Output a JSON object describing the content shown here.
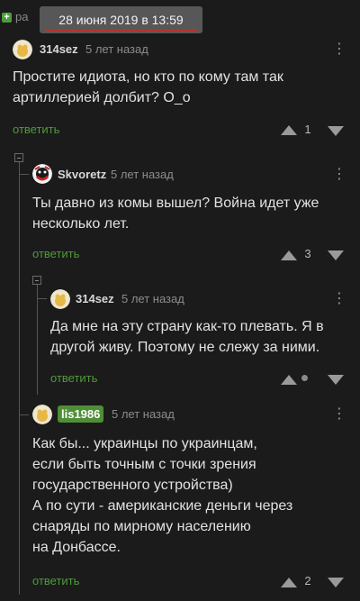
{
  "banner": {
    "prefix": "ра",
    "date": "28 июня 2019 в 13:59",
    "plus": "+"
  },
  "comments": [
    {
      "username": "314sez",
      "ago": "5 лет назад",
      "lines": [
        "Простите идиота, но кто по кому там так",
        "артиллерией долбит? О_о"
      ],
      "reply": "ответить",
      "rating": "1"
    },
    {
      "username": "Skvoretz",
      "ago": "5 лет назад",
      "lines": [
        "Ты давно из комы вышел? Война идет уже",
        "несколько лет."
      ],
      "reply": "ответить",
      "rating": "3"
    },
    {
      "username": "314sez",
      "ago": "5 лет назад",
      "lines": [
        "Да мне на эту страну как-то плевать. Я в",
        "другой живу. Поэтому не слежу за ними."
      ],
      "reply": "ответить",
      "rating": ""
    },
    {
      "username": "lis1986",
      "ago": "5 лет назад",
      "lines": [
        "Как бы... украинцы по украинцам,",
        "если быть точным с точки зрения",
        "государственного устройства)",
        "А по сути - американские деньги через",
        "снаряды по мирному населению",
        "на Донбассе."
      ],
      "reply": "ответить",
      "rating": "2"
    }
  ],
  "icons": {
    "more": "⋮",
    "up": "upvote-icon",
    "down": "downvote-icon"
  },
  "colors": {
    "background": "#1b1b1b",
    "reply": "#4f9a3a",
    "badge": "#4f8e36",
    "accent_red": "#b2362f"
  }
}
